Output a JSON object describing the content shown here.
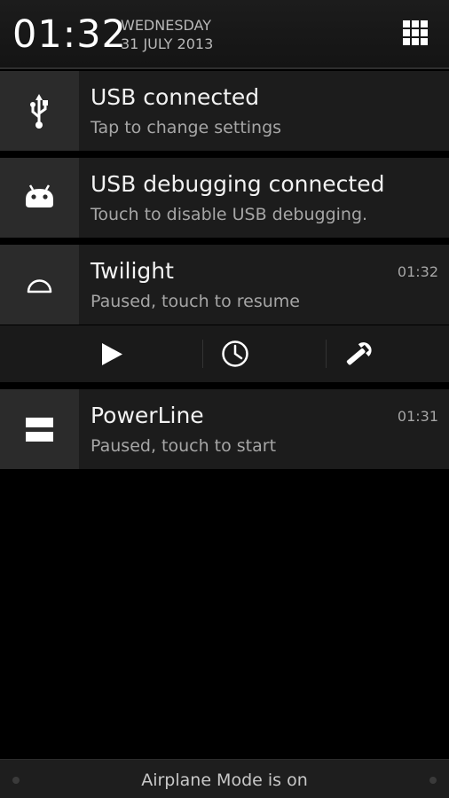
{
  "header": {
    "time": "01:32",
    "weekday": "WEDNESDAY",
    "date": "31 JULY 2013",
    "quick_settings_icon": "grid-icon"
  },
  "notifications": [
    {
      "title": "USB connected",
      "subtitle": "Tap to change settings",
      "icon": "usb-icon"
    },
    {
      "title": "USB debugging connected",
      "subtitle": "Touch to disable USB debugging.",
      "icon": "android-icon"
    },
    {
      "title": "Twilight",
      "subtitle": "Paused, touch to resume",
      "time": "01:32",
      "icon": "half-circle-icon",
      "actions": [
        {
          "icon": "play-icon"
        },
        {
          "icon": "clock-icon"
        },
        {
          "icon": "wrench-icon"
        }
      ]
    },
    {
      "title": "PowerLine",
      "subtitle": "Paused, touch to start",
      "time": "01:31",
      "icon": "bars-icon"
    }
  ],
  "footer": {
    "message": "Airplane Mode is on"
  },
  "colors": {
    "background": "#000000",
    "panel": "#1c1c1c",
    "icon_panel": "#2b2b2b",
    "text_primary": "#f2f2f2",
    "text_secondary": "#a6a6a6"
  }
}
